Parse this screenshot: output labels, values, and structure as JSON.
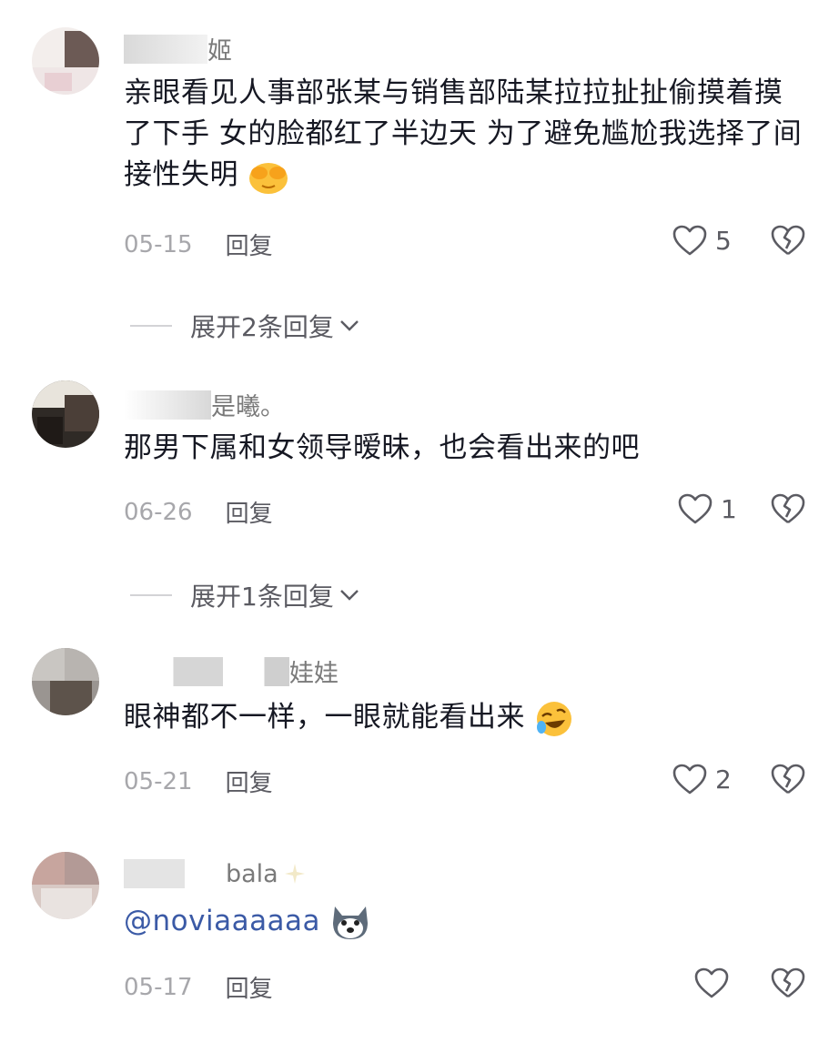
{
  "comments": [
    {
      "username": "姬",
      "text": "亲眼看见人事部张某与销售部陆某拉拉扯扯偷摸着摸了下手 女的脸都红了半边天 为了避免尴尬我选择了间接性失明",
      "date": "05-15",
      "reply_label": "回复",
      "likes": "5",
      "expand_label": "展开2条回复",
      "emoji": "face-covering-eyes-emoji"
    },
    {
      "username": "是曦。",
      "text": "那男下属和女领导暧昧，也会看出来的吧",
      "date": "06-26",
      "reply_label": "回复",
      "likes": "1",
      "expand_label": "展开1条回复"
    },
    {
      "username": "娃娃",
      "text": "眼神都不一样，一眼就能看出来",
      "date": "05-21",
      "reply_label": "回复",
      "likes": "2",
      "emoji": "rolling-laughing-emoji"
    },
    {
      "username": "bala",
      "text": "@noviaaaaaa",
      "date": "05-17",
      "reply_label": "回复",
      "likes": "",
      "emoji": "husky-dog-emoji"
    }
  ],
  "colors": {
    "text": "#161823",
    "secondary": "#a7a7ab",
    "action": "#5b5b62",
    "mention": "#3b5aa6"
  }
}
